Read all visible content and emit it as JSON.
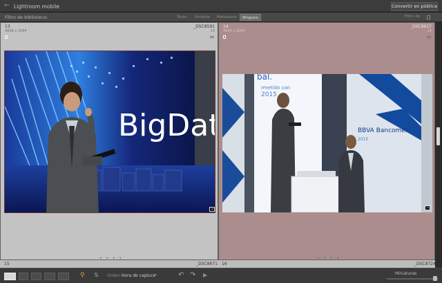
{
  "app": {
    "title": "Lightroom mobile",
    "convert_label": "Convertir en pública"
  },
  "filter": {
    "label": "Filtro de biblioteca:",
    "tabs": [
      "Texto",
      "Atributo",
      "Metadatos",
      "Ninguno"
    ],
    "active_tab": "Ninguno",
    "right_label": "Filtro de"
  },
  "cells": [
    {
      "number": "13",
      "dimensions": "4928 x 3264",
      "filename": "_DSC8591",
      "index_badge": "13",
      "selected": false
    },
    {
      "number": "14",
      "dimensions": "4928 x 3264",
      "filename": "_DSC8617",
      "index_badge": "14",
      "selected": true
    }
  ],
  "photo_13": {
    "headline": "BigData"
  },
  "photo_14": {
    "brand": "BBVA Bancomer",
    "year": "2015",
    "side_year": "2015"
  },
  "next_row": [
    {
      "number": "15",
      "filename": "_DSC8671"
    },
    {
      "number": "16",
      "filename": "_DSC8724"
    }
  ],
  "grid_dots": "• • • •",
  "toolbar": {
    "sort_label": "Orden:",
    "sort_value": "Hora de captura",
    "thumbnails_label": "Miniaturas",
    "thumbnail_size": 0.95
  },
  "colors": {
    "selected_cell": "#ab8d8d",
    "cell": "#c3c3c3",
    "toolbar": "#3a3a3a"
  }
}
